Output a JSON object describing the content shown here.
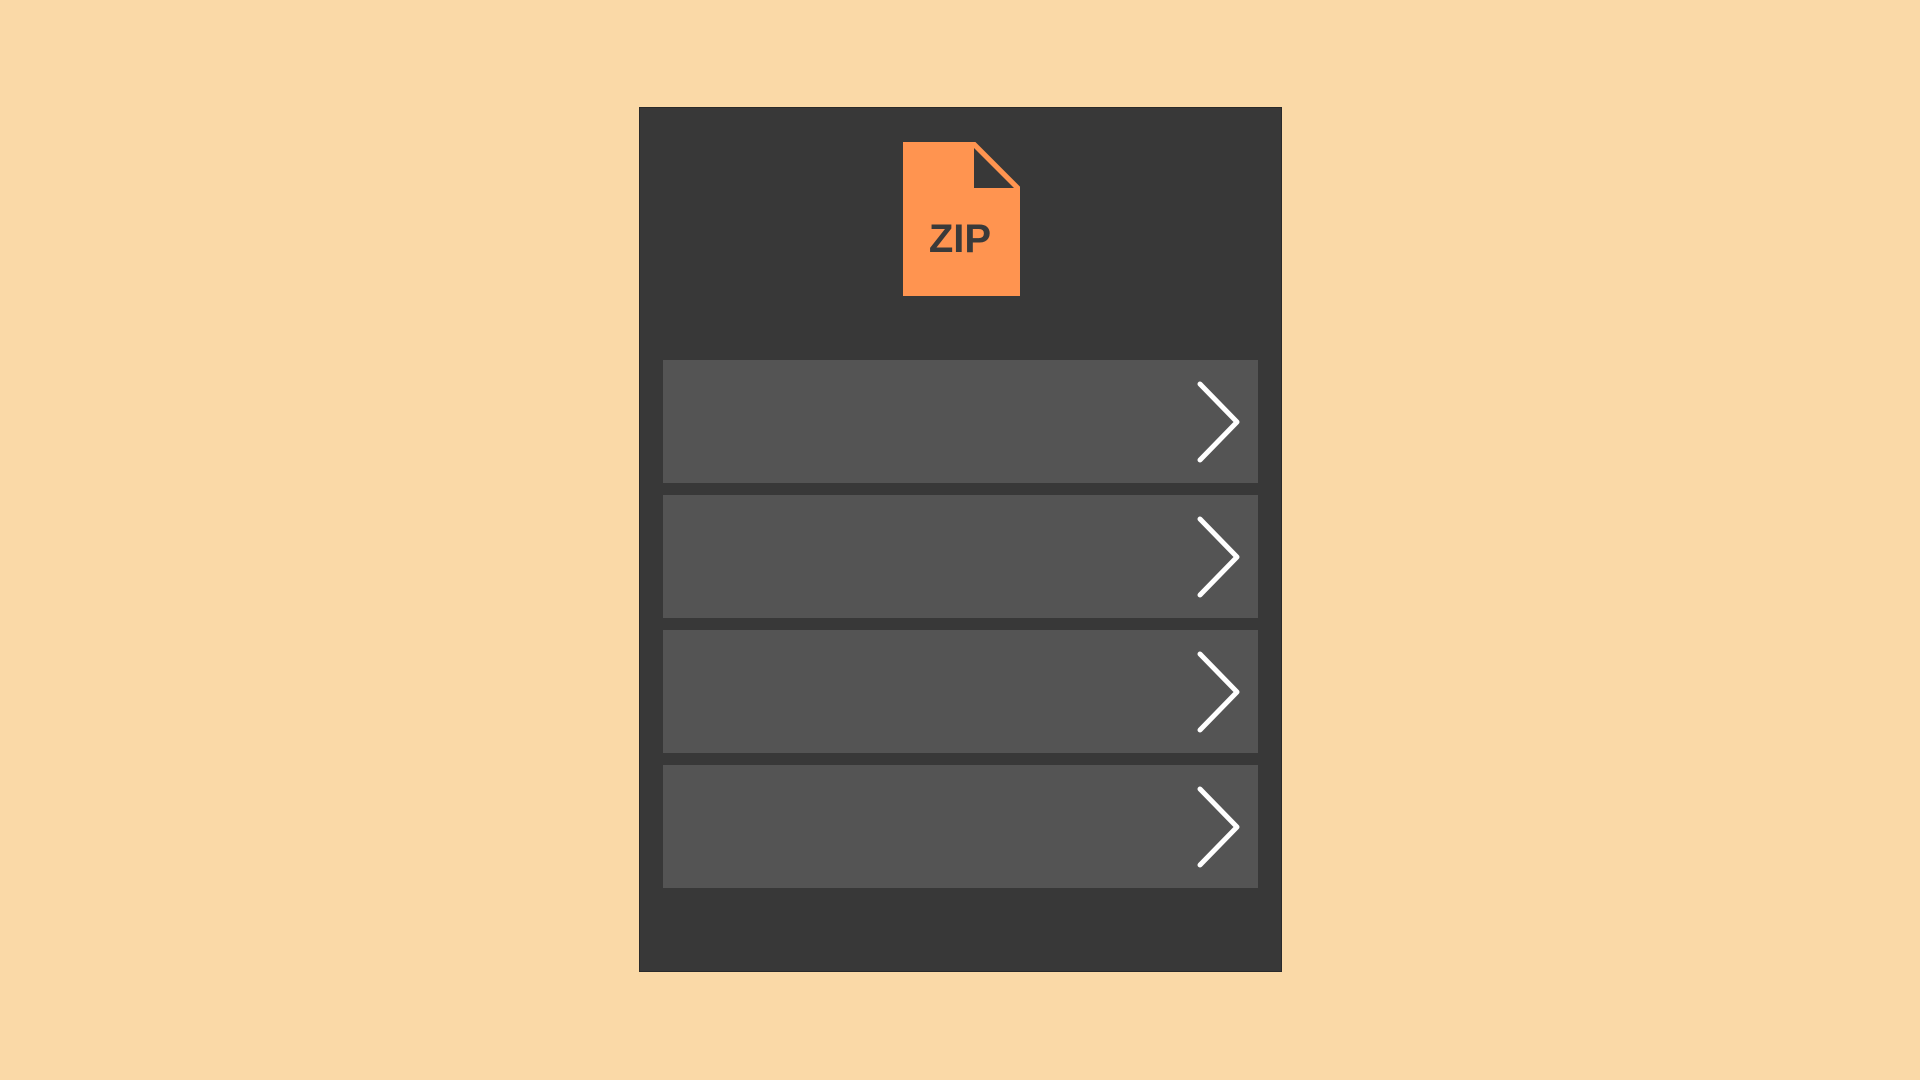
{
  "panel": {
    "icon": {
      "name": "zip-file-icon",
      "label": "ZIP",
      "color": "#FF9450",
      "text_color": "#3A3A3A"
    },
    "rows": [
      {
        "label": "",
        "icon": "chevron-right-icon"
      },
      {
        "label": "",
        "icon": "chevron-right-icon"
      },
      {
        "label": "",
        "icon": "chevron-right-icon"
      },
      {
        "label": "",
        "icon": "chevron-right-icon"
      }
    ]
  },
  "colors": {
    "background": "#FAD9A7",
    "panel": "#383838",
    "row": "#545454",
    "chevron": "#FFFFFF"
  }
}
